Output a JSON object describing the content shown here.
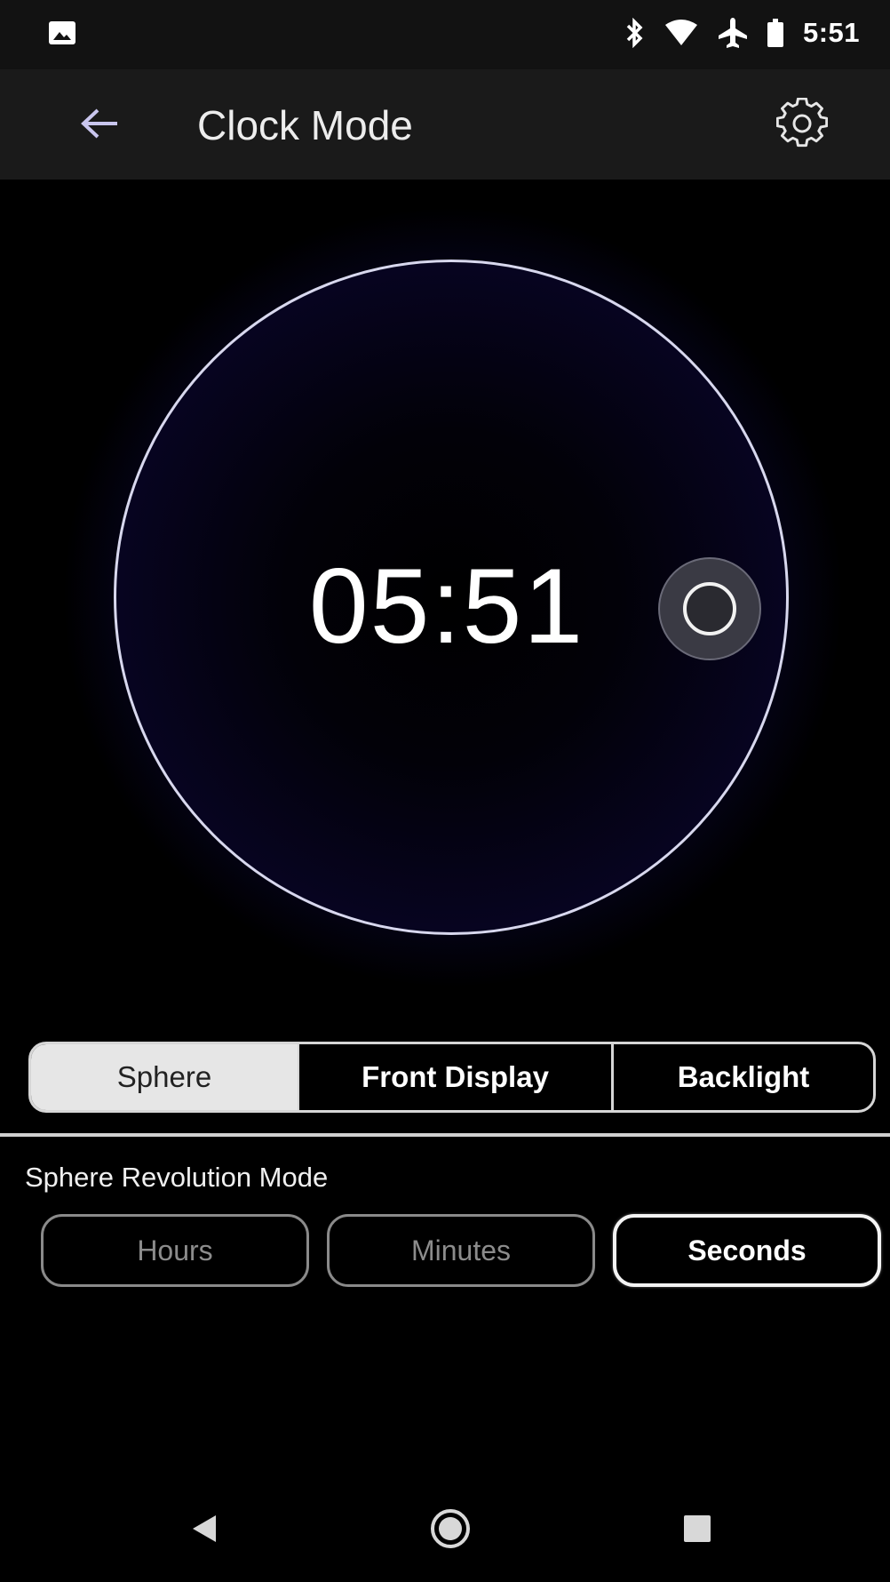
{
  "status_bar": {
    "time": "5:51",
    "icons": [
      "gallery-icon",
      "bluetooth-icon",
      "wifi-icon",
      "airplane-icon",
      "battery-icon"
    ]
  },
  "app_bar": {
    "title": "Clock Mode",
    "back_icon": "arrow-left-icon",
    "settings_icon": "gear-icon"
  },
  "sphere": {
    "time": "05:51",
    "glow_color": "#2a1cf0"
  },
  "tabs": [
    {
      "label": "Sphere",
      "selected": true
    },
    {
      "label": "Front Display",
      "selected": false
    },
    {
      "label": "Backlight",
      "selected": false
    }
  ],
  "revolution": {
    "label": "Sphere Revolution Mode",
    "options": [
      {
        "label": "Hours",
        "selected": false
      },
      {
        "label": "Minutes",
        "selected": false
      },
      {
        "label": "Seconds",
        "selected": true
      }
    ]
  },
  "nav_bar": {
    "icons": [
      "nav-back-icon",
      "nav-home-icon",
      "nav-recents-icon"
    ]
  }
}
